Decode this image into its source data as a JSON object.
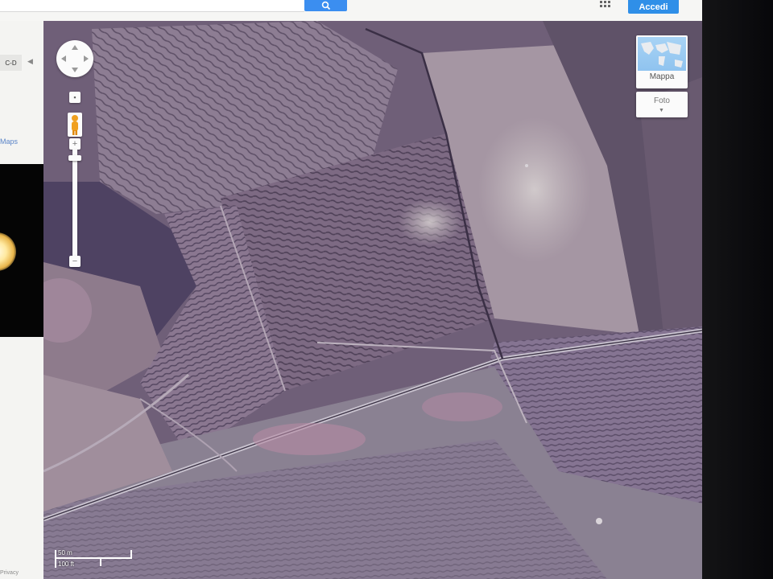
{
  "topbar": {
    "signin_label": "Accedi",
    "search_icon": "search-icon",
    "apps_icon": "apps-grid-icon"
  },
  "leftpanel": {
    "badge_text": "C-D",
    "maps_link": "Maps",
    "collapse_icon": "chevron-left-icon",
    "footer": "Privacy"
  },
  "map": {
    "view": "satellite",
    "map_type": {
      "map_label": "Mappa",
      "photo_label": "Foto"
    },
    "scale": {
      "metric": "50 m",
      "imperial": "100 ft"
    }
  },
  "colors": {
    "accent_blue": "#2f8fe8",
    "imagery_tint": "#6b5a73"
  }
}
